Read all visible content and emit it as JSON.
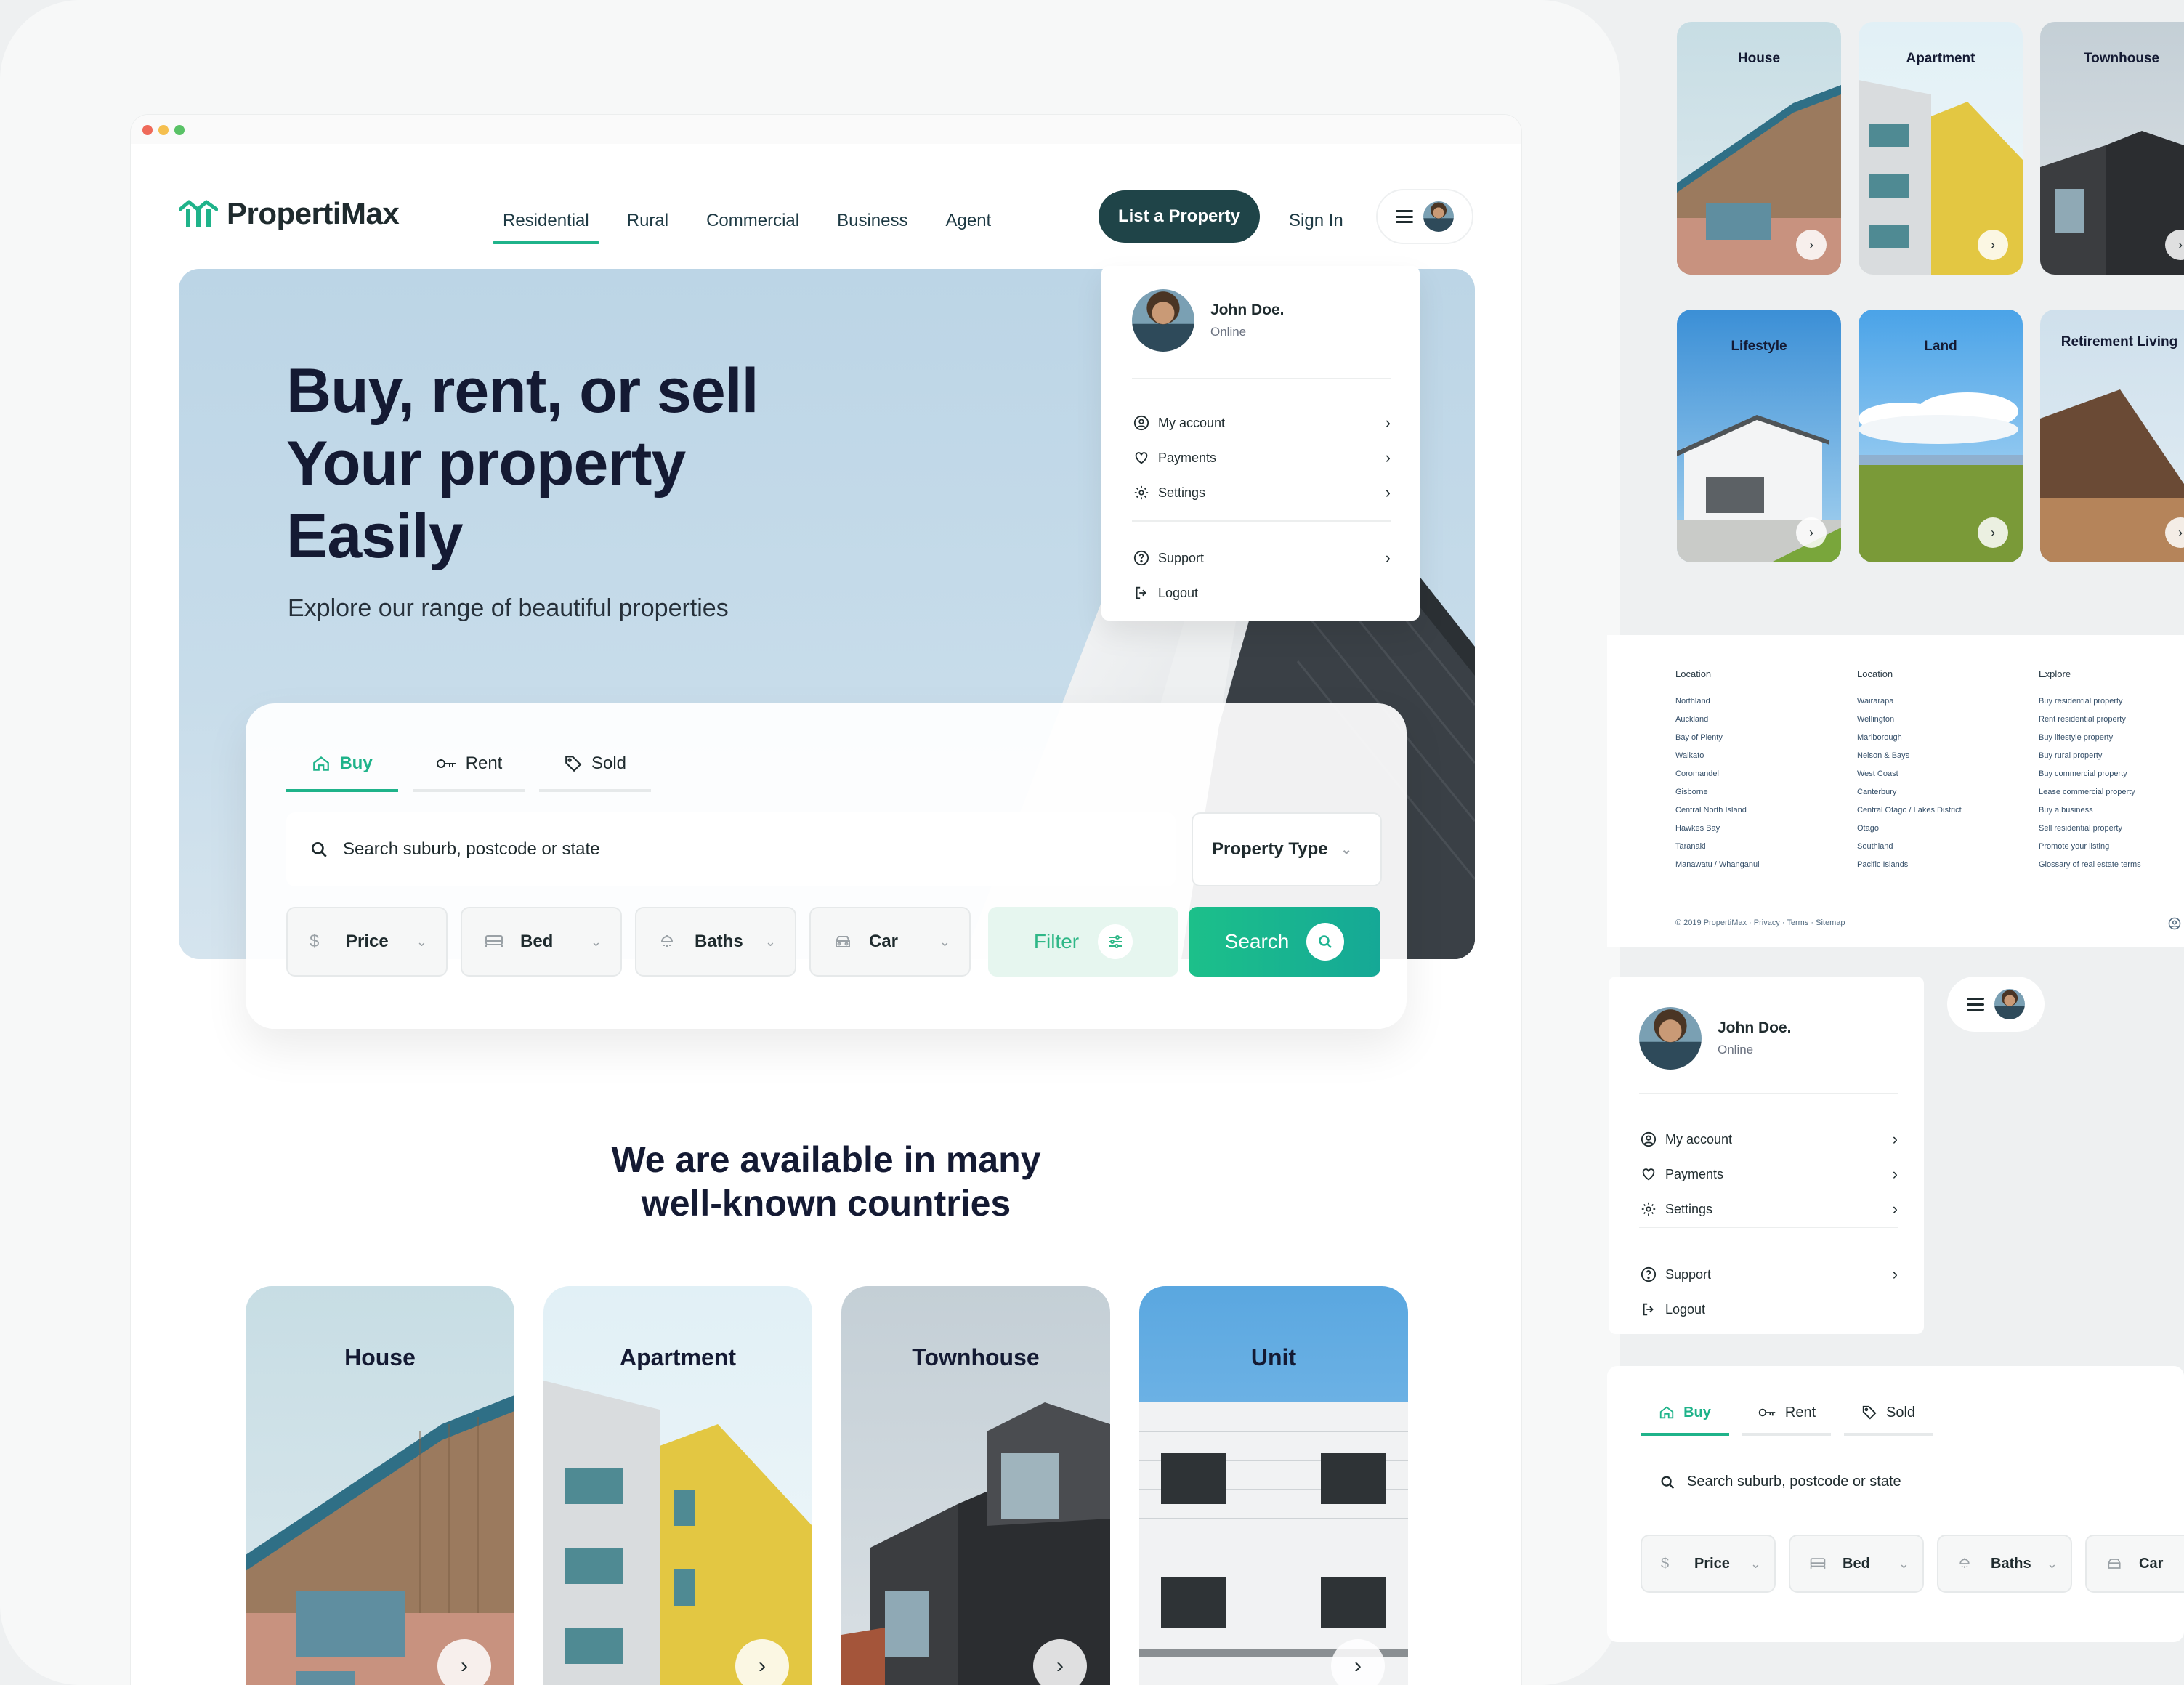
{
  "brand": {
    "name": "PropertiMax",
    "color": "#1fb38a",
    "dark": "#1f4448"
  },
  "nav": {
    "items": [
      "Residential",
      "Rural",
      "Commercial",
      "Business",
      "Agent"
    ],
    "active": "Residential",
    "list_property": "List a Property",
    "sign_in": "Sign In"
  },
  "hero": {
    "headline": [
      "Buy, rent, or sell",
      "Your property",
      "Easily"
    ],
    "subtitle": "Explore our range of beautiful properties"
  },
  "user_menu": {
    "name": "John Doe.",
    "status": "Online",
    "items": [
      {
        "label": "My account",
        "icon": "user-circle-icon"
      },
      {
        "label": "Payments",
        "icon": "heart-icon"
      },
      {
        "label": "Settings",
        "icon": "gear-icon"
      },
      {
        "label": "Support",
        "icon": "help-circle-icon"
      },
      {
        "label": "Logout",
        "icon": "logout-icon"
      }
    ]
  },
  "search": {
    "tabs": [
      "Buy",
      "Rent",
      "Sold"
    ],
    "active_tab": "Buy",
    "placeholder": "Search suburb, postcode or state",
    "property_type": "Property Type",
    "filters": [
      "Price",
      "Bed",
      "Baths",
      "Car"
    ],
    "filter_button": "Filter",
    "search_button": "Search"
  },
  "section": {
    "title": [
      "We are available in many",
      "well-known countries"
    ]
  },
  "categories": [
    "House",
    "Apartment",
    "Townhouse",
    "Unit"
  ],
  "right_categories": [
    "House",
    "Apartment",
    "Townhouse",
    "Lifestyle",
    "Land",
    "Retirement Living"
  ],
  "footer": {
    "columns": [
      {
        "heading": "Location",
        "links": [
          "Northland",
          "Auckland",
          "Bay of Plenty",
          "Waikato",
          "Coromandel",
          "Gisborne",
          "Central North Island",
          "Hawkes Bay",
          "Taranaki",
          "Manawatu / Whanganui"
        ]
      },
      {
        "heading": "Location",
        "links": [
          "Wairarapa",
          "Wellington",
          "Marlborough",
          "Nelson & Bays",
          "West Coast",
          "Canterbury",
          "Central Otago / Lakes District",
          "Otago",
          "Southland",
          "Pacific Islands"
        ]
      },
      {
        "heading": "Explore",
        "links": [
          "Buy residential property",
          "Rent residential property",
          "Buy lifestyle property",
          "Buy rural property",
          "Buy commercial property",
          "Lease commercial property",
          "Buy a business",
          "Sell residential property",
          "Promote your listing",
          "Glossary of real estate terms"
        ]
      }
    ],
    "copyright": "© 2019 PropertiMax · Privacy · Terms · Sitemap"
  }
}
